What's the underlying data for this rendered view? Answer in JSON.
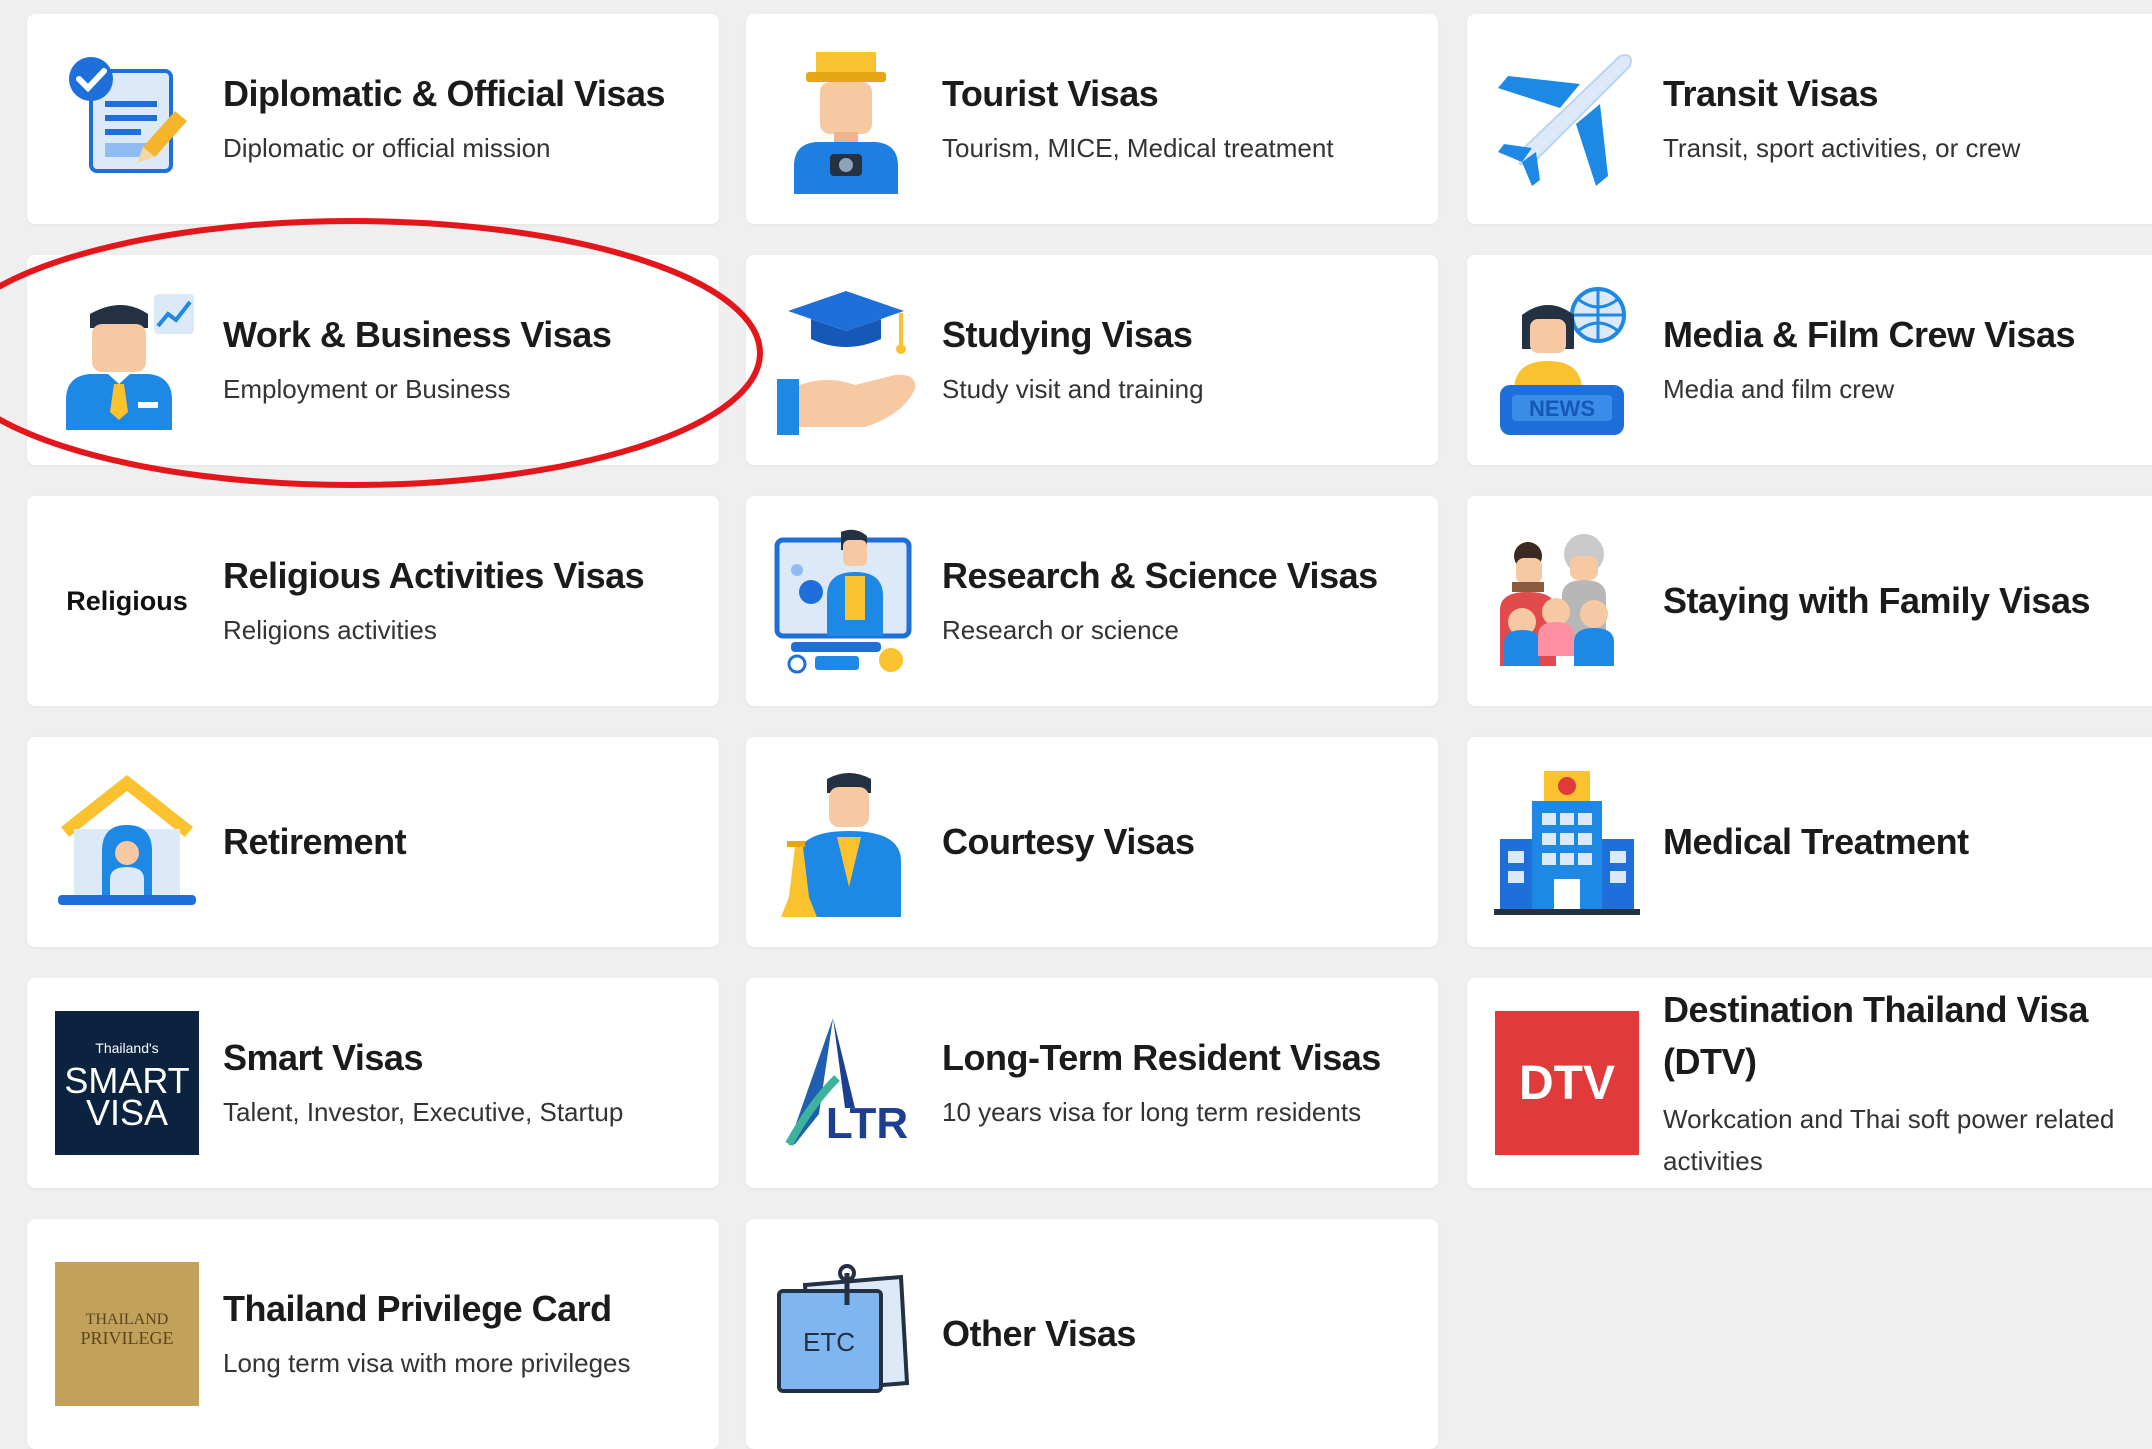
{
  "cards": [
    {
      "title": "Diplomatic & Official Visas",
      "subtitle": "Diplomatic or official mission",
      "icon": "diplomatic-document-icon"
    },
    {
      "title": "Tourist Visas",
      "subtitle": "Tourism, MICE, Medical treatment",
      "icon": "tourist-icon"
    },
    {
      "title": "Transit Visas",
      "subtitle": "Transit, sport activities, or crew",
      "icon": "airplane-icon"
    },
    {
      "title": "Work & Business Visas",
      "subtitle": "Employment or Business",
      "icon": "businessman-icon"
    },
    {
      "title": "Studying Visas",
      "subtitle": "Study visit and training",
      "icon": "graduation-cap-icon"
    },
    {
      "title": "Media & Film Crew Visas",
      "subtitle": "Media and film crew",
      "icon": "news-reporter-icon"
    },
    {
      "title": "Religious Activities Visas",
      "subtitle": "Religions activities",
      "icon": "religious-text-icon",
      "icon_text": "Religious"
    },
    {
      "title": "Research & Science Visas",
      "subtitle": "Research or science",
      "icon": "research-scientist-icon"
    },
    {
      "title": "Staying with Family Visas",
      "subtitle": "",
      "icon": "family-icon"
    },
    {
      "title": "Retirement",
      "subtitle": "",
      "icon": "retirement-house-icon"
    },
    {
      "title": "Courtesy Visas",
      "subtitle": "",
      "icon": "courtesy-greeting-icon"
    },
    {
      "title": "Medical Treatment",
      "subtitle": "",
      "icon": "hospital-icon"
    },
    {
      "title": "Smart Visas",
      "subtitle": "Talent, Investor, Executive, Startup",
      "icon": "smart-visa-logo-icon",
      "icon_text": [
        "Thailand's",
        "SMART",
        "VISA"
      ]
    },
    {
      "title": "Long-Term Resident Visas",
      "subtitle": "10 years visa for long term residents",
      "icon": "ltr-logo-icon",
      "icon_text": "LTR"
    },
    {
      "title": "Destination Thailand Visa (DTV)",
      "subtitle": "Workcation and Thai soft power related activities",
      "icon": "dtv-logo-icon",
      "icon_text": "DTV"
    },
    {
      "title": "Thailand Privilege Card",
      "subtitle": "Long term visa with more privileges",
      "icon": "thailand-privilege-logo-icon",
      "icon_text": [
        "THAILAND",
        "PRIVILEGE"
      ]
    },
    {
      "title": "Other Visas",
      "subtitle": "",
      "icon": "etc-clipboard-icon",
      "icon_text": "ETC"
    }
  ],
  "colors": {
    "background": "#efefef",
    "card": "#ffffff",
    "accent_blue": "#1e88e5",
    "accent_yellow": "#f9c22e",
    "highlight_oval": "#e3161b",
    "dtv_red": "#e03a3a",
    "smart_navy": "#0c2340",
    "privilege_gold": "#c2a25b"
  }
}
